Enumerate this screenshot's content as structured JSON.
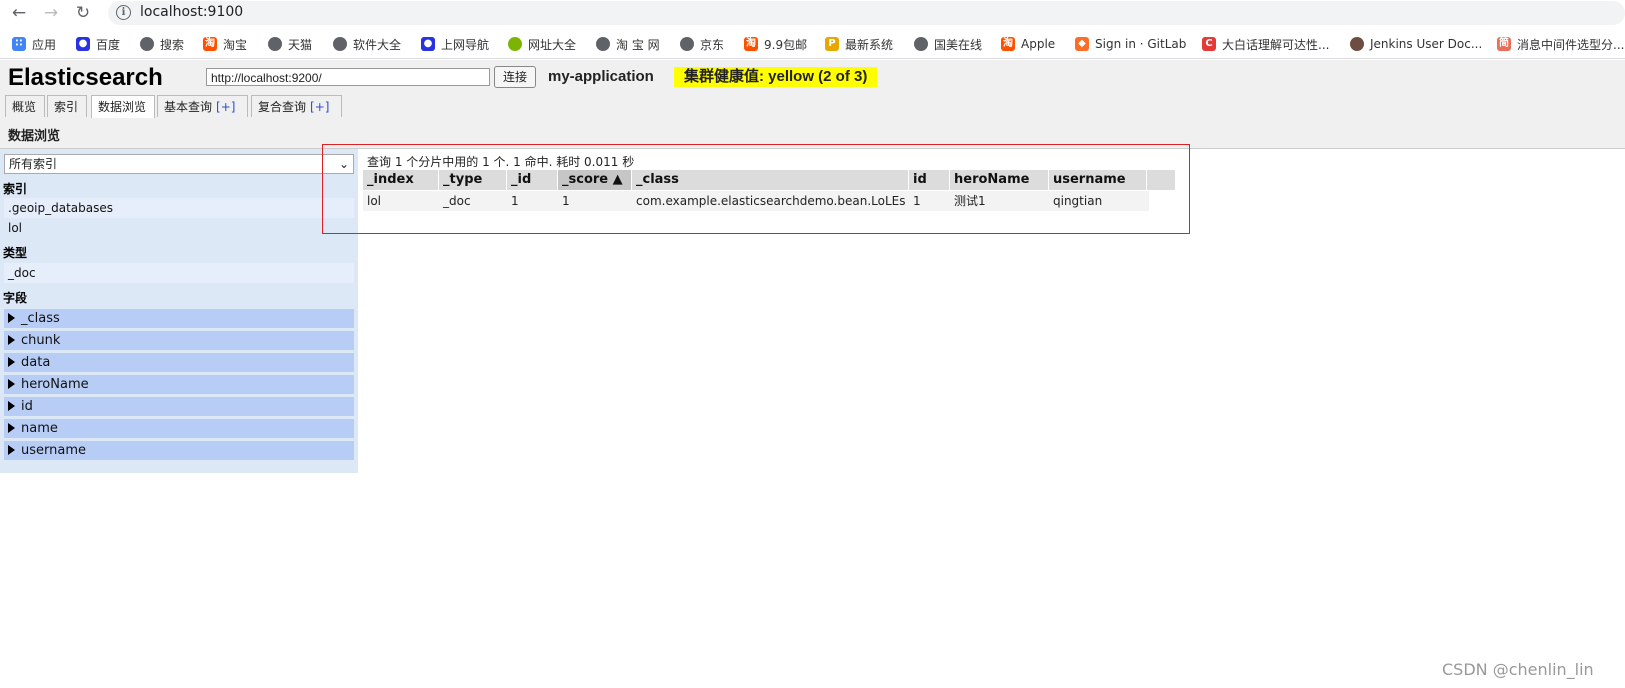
{
  "browser": {
    "url": "localhost:9100",
    "bookmarks": [
      {
        "label": "应用",
        "icon": "apps-grid-icon",
        "color": "#4285f4"
      },
      {
        "label": "百度",
        "icon": "baidu-paw-icon",
        "color": "#2932e1"
      },
      {
        "label": "搜索",
        "icon": "globe-icon",
        "color": "#5f6368"
      },
      {
        "label": "淘宝",
        "icon": "taobao-icon",
        "color": "#ff5000"
      },
      {
        "label": "天猫",
        "icon": "globe-icon",
        "color": "#5f6368"
      },
      {
        "label": "软件大全",
        "icon": "globe-icon",
        "color": "#5f6368"
      },
      {
        "label": "上网导航",
        "icon": "baidu-paw-icon",
        "color": "#2932e1"
      },
      {
        "label": "网址大全",
        "icon": "360-icon",
        "color": "#7cb305"
      },
      {
        "label": "淘 宝 网",
        "icon": "globe-icon",
        "color": "#5f6368"
      },
      {
        "label": "京东",
        "icon": "globe-icon",
        "color": "#5f6368"
      },
      {
        "label": "9.9包邮",
        "icon": "taobao-icon",
        "color": "#ff5000"
      },
      {
        "label": "最新系统",
        "icon": "pma-icon",
        "color": "#e6a700"
      },
      {
        "label": "国美在线",
        "icon": "globe-icon",
        "color": "#5f6368"
      },
      {
        "label": "Apple",
        "icon": "taobao-icon",
        "color": "#ff5000"
      },
      {
        "label": "Sign in · GitLab",
        "icon": "gitlab-icon",
        "color": "#fc6d26"
      },
      {
        "label": "大白话理解可达性...",
        "icon": "csdn-icon",
        "color": "#e53935"
      },
      {
        "label": "Jenkins User Doc...",
        "icon": "jenkins-icon",
        "color": "#6d4c41"
      },
      {
        "label": "消息中间件选型分...",
        "icon": "jianshu-icon",
        "color": "#ea6f5a"
      }
    ]
  },
  "app": {
    "title": "Elasticsearch",
    "server_url": "http://localhost:9200/",
    "connect_label": "连接",
    "cluster_name": "my-application",
    "health": "集群健康值: yellow (2 of 3)",
    "health_color": "#ffff00",
    "tabs": [
      {
        "label": "概览"
      },
      {
        "label": "索引"
      },
      {
        "label": "数据浏览"
      },
      {
        "label": "基本查询",
        "plus": "[+]"
      },
      {
        "label": "复合查询",
        "plus": "[+]"
      }
    ],
    "section_title": "数据浏览"
  },
  "sidebar": {
    "index_select": "所有索引",
    "indices_label": "索引",
    "indices": [
      ".geoip_databases",
      "lol"
    ],
    "types_label": "类型",
    "types": [
      "_doc"
    ],
    "fields_label": "字段",
    "fields": [
      "_class",
      "chunk",
      "data",
      "heroName",
      "id",
      "name",
      "username"
    ]
  },
  "results": {
    "summary": "查询 1 个分片中用的 1 个. 1 命中. 耗时 0.011 秒",
    "columns": [
      "_index",
      "_type",
      "_id",
      "_score ▲",
      "_class",
      "id",
      "heroName",
      "username"
    ],
    "rows": [
      [
        "lol",
        "_doc",
        "1",
        "1",
        "com.example.elasticsearchdemo.bean.LoLEs",
        "1",
        "测试1",
        "qingtian"
      ]
    ]
  },
  "watermark": "CSDN @chenlin_lin"
}
